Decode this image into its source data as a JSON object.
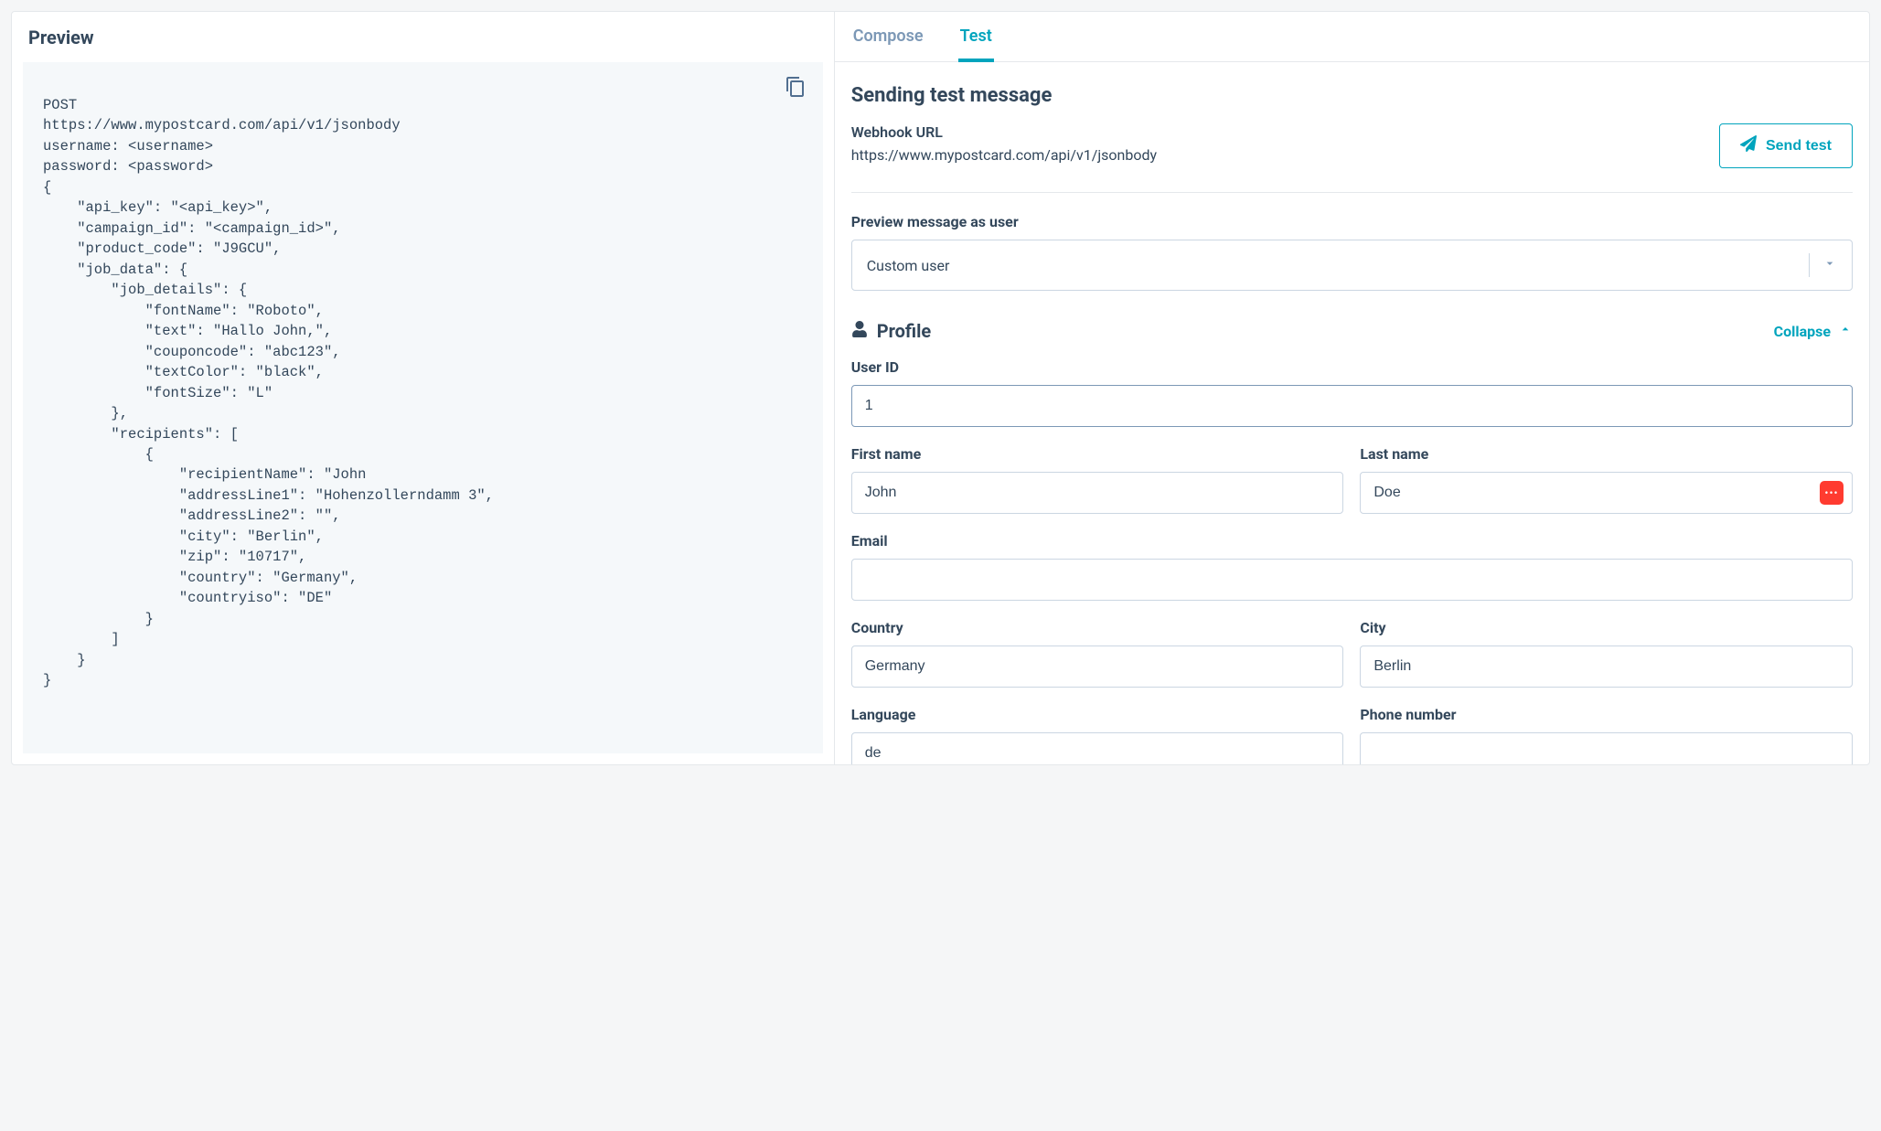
{
  "left": {
    "heading": "Preview",
    "code": "POST\nhttps://www.mypostcard.com/api/v1/jsonbody\nusername: <username>\npassword: <password>\n{\n    \"api_key\": \"<api_key>\",\n    \"campaign_id\": \"<campaign_id>\",\n    \"product_code\": \"J9GCU\",\n    \"job_data\": {\n        \"job_details\": {\n            \"fontName\": \"Roboto\",\n            \"text\": \"Hallo John,\",\n            \"couponcode\": \"abc123\",\n            \"textColor\": \"black\",\n            \"fontSize\": \"L\"\n        },\n        \"recipients\": [\n            {\n                \"recipientName\": \"John\n                \"addressLine1\": \"Hohenzollerndamm 3\",\n                \"addressLine2\": \"\",\n                \"city\": \"Berlin\",\n                \"zip\": \"10717\",\n                \"country\": \"Germany\",\n                \"countryiso\": \"DE\"\n            }\n        ]\n    }\n}"
  },
  "tabs": {
    "compose": "Compose",
    "test": "Test"
  },
  "test": {
    "heading": "Sending test message",
    "webhook_label": "Webhook URL",
    "webhook_url": "https://www.mypostcard.com/api/v1/jsonbody",
    "send_test_label": "Send test",
    "preview_as_label": "Preview message as user",
    "preview_as_value": "Custom user"
  },
  "profile": {
    "heading": "Profile",
    "collapse_label": "Collapse",
    "fields": {
      "user_id": {
        "label": "User ID",
        "value": "1"
      },
      "first_name": {
        "label": "First name",
        "value": "John"
      },
      "last_name": {
        "label": "Last name",
        "value": "Doe"
      },
      "email": {
        "label": "Email",
        "value": ""
      },
      "country": {
        "label": "Country",
        "value": "Germany"
      },
      "city": {
        "label": "City",
        "value": "Berlin"
      },
      "language": {
        "label": "Language",
        "value": "de"
      },
      "phone": {
        "label": "Phone number",
        "value": ""
      }
    }
  }
}
